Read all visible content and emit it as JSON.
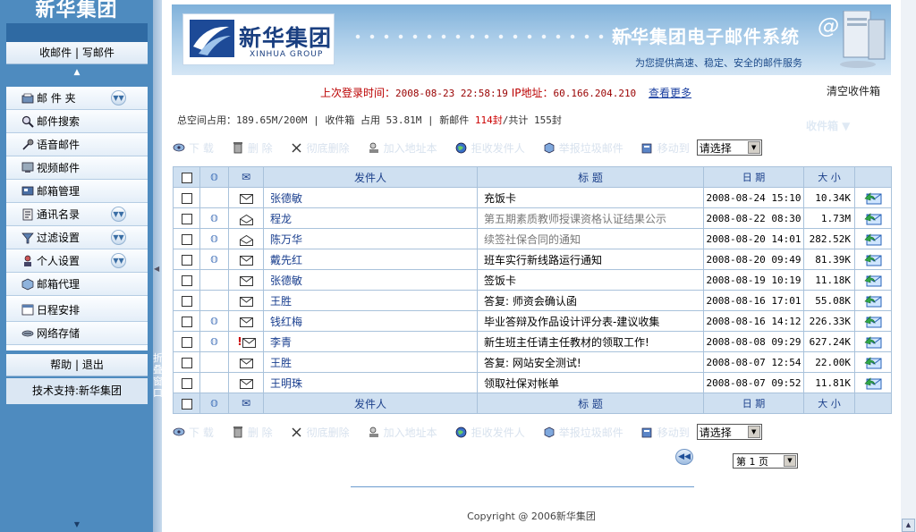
{
  "sidebar": {
    "brand": "新华集团",
    "mail_links": {
      "inbox": "收邮件",
      "separator": "|",
      "compose": "写邮件"
    },
    "items": [
      {
        "label": "邮 件 夹",
        "icon": "mailbox-icon",
        "expandable": true
      },
      {
        "label": "邮件搜索",
        "icon": "search-icon",
        "expandable": false
      },
      {
        "label": "语音邮件",
        "icon": "microphone-icon",
        "expandable": false
      },
      {
        "label": "视频邮件",
        "icon": "video-icon",
        "expandable": false
      },
      {
        "label": "邮箱管理",
        "icon": "manage-icon",
        "expandable": false
      },
      {
        "label": "通讯名录",
        "icon": "contacts-icon",
        "expandable": true
      },
      {
        "label": "过滤设置",
        "icon": "filter-icon",
        "expandable": true
      },
      {
        "label": "个人设置",
        "icon": "user-settings-icon",
        "expandable": true
      },
      {
        "label": "邮箱代理",
        "icon": "proxy-icon",
        "expandable": false
      },
      {
        "label": "日程安排",
        "icon": "calendar-icon",
        "expandable": false
      },
      {
        "label": "网络存储",
        "icon": "storage-icon",
        "expandable": false
      }
    ],
    "help": "帮助",
    "help_separator": "|",
    "logout": "退出",
    "support": "技术支持:新华集团",
    "collapse_text": "折叠窗口"
  },
  "banner": {
    "logo_text": "新华集团",
    "logo_sub": "XINHUA GROUP",
    "title": "新华集团电子邮件系统",
    "slogan": "为您提供高速、稳定、安全的邮件服务"
  },
  "login": {
    "label": "上次登录时间：",
    "time": "2008-08-23 22:58:19",
    "ip_label": "IP地址：",
    "ip": "60.166.204.210",
    "more": "查看更多",
    "clear_inbox": "清空收件箱"
  },
  "space": {
    "total_label": "总空间占用：",
    "total_used": "189.65M/200M",
    "inbox_label": "收件箱 占用",
    "inbox_used": "53.81M",
    "new_label": "新邮件",
    "new_count": "114封",
    "total_count": "/共计 155封",
    "folder_label": "收件箱 ▼"
  },
  "toolbar": {
    "download": "下 载",
    "delete": "删 除",
    "delete_permanently": "彻底删除",
    "add_address": "加入地址本",
    "reject_sender": "拒收发件人",
    "report_spam": "举报垃圾邮件",
    "move_to": "移动到",
    "select_placeholder": "请选择"
  },
  "table": {
    "headers": {
      "from": "发件人",
      "subject": "标 题",
      "date": "日 期",
      "size": "大 小"
    },
    "rows": [
      {
        "from": "张德敏",
        "subject": "充饭卡",
        "date": "2008-08-24 15:10",
        "size": "10.34K",
        "attachment": false,
        "read": false,
        "urgent": false
      },
      {
        "from": "程龙",
        "subject": "第五期素质教师授课资格认证结果公示",
        "date": "2008-08-22 08:30",
        "size": "1.73M",
        "attachment": true,
        "read": true,
        "urgent": false
      },
      {
        "from": "陈万华",
        "subject": "续签社保合同的通知",
        "date": "2008-08-20 14:01",
        "size": "282.52K",
        "attachment": true,
        "read": true,
        "urgent": false
      },
      {
        "from": "戴先红",
        "subject": "班车实行新线路运行通知",
        "date": "2008-08-20 09:49",
        "size": "81.39K",
        "attachment": true,
        "read": false,
        "urgent": false
      },
      {
        "from": "张德敏",
        "subject": "签饭卡",
        "date": "2008-08-19 10:19",
        "size": "11.18K",
        "attachment": false,
        "read": false,
        "urgent": false
      },
      {
        "from": "王胜",
        "subject": "答复: 师资会确认函",
        "date": "2008-08-16 17:01",
        "size": "55.08K",
        "attachment": false,
        "read": false,
        "urgent": false
      },
      {
        "from": "钱红梅",
        "subject": "毕业答辩及作品设计评分表-建议收集",
        "date": "2008-08-16 14:12",
        "size": "226.33K",
        "attachment": true,
        "read": false,
        "urgent": false
      },
      {
        "from": "李青",
        "subject": "新生班主任请主任教材的领取工作!",
        "date": "2008-08-08 09:29",
        "size": "627.24K",
        "attachment": true,
        "read": false,
        "urgent": true
      },
      {
        "from": "王胜",
        "subject": "答复: 网站安全测试!",
        "date": "2008-08-07 12:54",
        "size": "22.00K",
        "attachment": false,
        "read": false,
        "urgent": false
      },
      {
        "from": "王明珠",
        "subject": "领取社保对帐单",
        "date": "2008-08-07 09:52",
        "size": "11.81K",
        "attachment": false,
        "read": false,
        "urgent": false
      }
    ]
  },
  "pagination": {
    "page": "第 1 页"
  },
  "footer": {
    "copyright": "Copyright @ 2006新华集团"
  },
  "colors": {
    "sidebar": "#4e8bbf",
    "header_row": "#cfe0f1",
    "urgent": "#c00000",
    "link": "#1a3fa0"
  }
}
